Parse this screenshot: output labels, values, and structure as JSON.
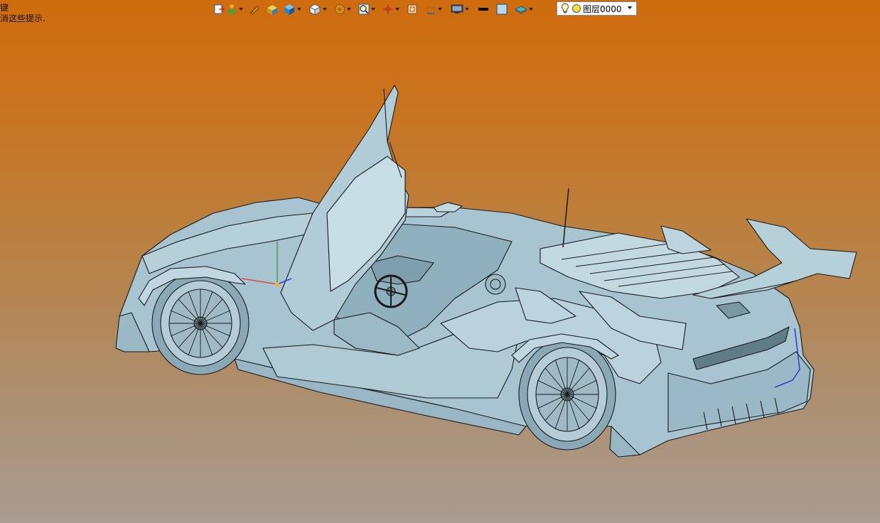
{
  "hints": {
    "line1": "键",
    "line2": "消这些提示."
  },
  "toolbar": {
    "icons": [
      "exit-sketch-icon",
      "constraints-icon",
      "pen-icon",
      "extrude-icon",
      "solid-box-icon",
      "view-orient-icon",
      "render-style-icon",
      "zoom-icon",
      "snap-icon",
      "fit-view-icon",
      "section-icon",
      "display-icon",
      "line-color-icon",
      "fill-color-icon",
      "layer-view-icon"
    ],
    "layer": {
      "value": "图层0000"
    }
  },
  "colors": {
    "background_top": "#cf6c0e",
    "background_bottom": "#a99c92",
    "model_fill": "#a7c4d0",
    "model_edge": "#1a1a1a"
  }
}
